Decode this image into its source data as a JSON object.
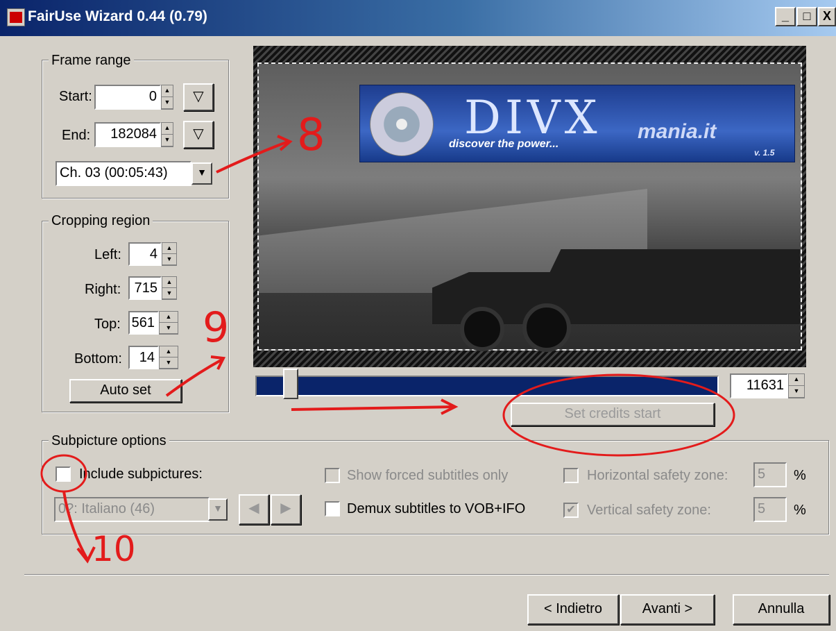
{
  "window": {
    "title": "FairUse Wizard 0.44 (0.79)",
    "icon": "fairuse-app-icon",
    "controls": {
      "minimize": "_",
      "maximize": "□",
      "close": "X"
    }
  },
  "frame_range": {
    "legend": "Frame range",
    "start_label": "Start:",
    "start_value": "0",
    "end_label": "End:",
    "end_value": "182084",
    "chapter": "Ch. 03  (00:05:43)"
  },
  "cropping": {
    "legend": "Cropping region",
    "left_label": "Left:",
    "left_value": "4",
    "right_label": "Right:",
    "right_value": "715",
    "top_label": "Top:",
    "top_value": "561",
    "bottom_label": "Bottom:",
    "bottom_value": "14",
    "auto_set": "Auto set"
  },
  "preview": {
    "banner_logo": "DIVX",
    "banner_tagline": "discover the power...",
    "banner_site": "mania.it",
    "banner_version": "v. 1.5",
    "frame_value": "11631",
    "set_credits": "Set credits start",
    "slider_position": 0.06
  },
  "subpicture": {
    "legend": "Subpicture options",
    "include_label": "Include subpictures:",
    "include_checked": false,
    "track": "0?: Italiano (46)",
    "show_forced_label": "Show forced subtitles only",
    "demux_label": "Demux subtitles to VOB+IFO",
    "horizontal_label": "Horizontal safety zone:",
    "vertical_label": "Vertical safety zone:",
    "horizontal_value": "5",
    "vertical_value": "5",
    "percent": "%",
    "vertical_checked": true
  },
  "nav": {
    "back": "< Indietro",
    "next": "Avanti >",
    "cancel": "Annulla"
  },
  "annotations": {
    "n8": "8",
    "n9": "9",
    "n10": "10",
    "color": "#e31b1b"
  }
}
